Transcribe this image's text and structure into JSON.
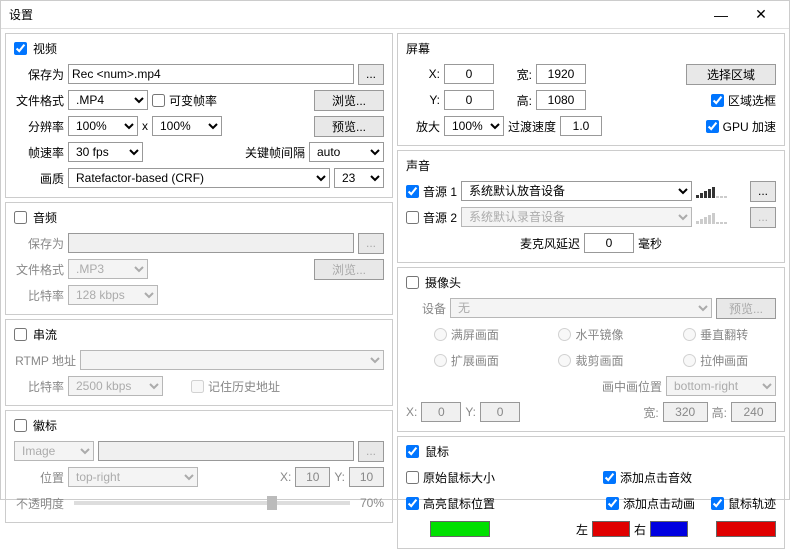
{
  "window": {
    "title": "设置",
    "min": "—",
    "close": "✕"
  },
  "video": {
    "title": "视频",
    "checked": true,
    "saveas_lbl": "保存为",
    "saveas_val": "Rec <num>.mp4",
    "more": "...",
    "format_lbl": "文件格式",
    "format_val": ".MP4",
    "vbr_lbl": "可变帧率",
    "browse": "浏览...",
    "res_lbl": "分辨率",
    "res_w": "100%",
    "res_x": "x",
    "res_h": "100%",
    "preview": "预览...",
    "fps_lbl": "帧速率",
    "fps_val": "30 fps",
    "keyframe_lbl": "关键帧间隔",
    "keyframe_val": "auto",
    "quality_lbl": "画质",
    "quality_val": "Ratefactor-based (CRF)",
    "crf_val": "23"
  },
  "audio": {
    "title": "音频",
    "checked": false,
    "saveas_lbl": "保存为",
    "saveas_val": "",
    "more": "...",
    "format_lbl": "文件格式",
    "format_val": ".MP3",
    "browse": "浏览...",
    "bitrate_lbl": "比特率",
    "bitrate_val": "128 kbps"
  },
  "stream": {
    "title": "串流",
    "checked": false,
    "rtmp_lbl": "RTMP 地址",
    "rtmp_val": "",
    "bitrate_lbl": "比特率",
    "bitrate_val": "2500 kbps",
    "remember_lbl": "记住历史地址"
  },
  "emblem": {
    "title": "徽标",
    "checked": false,
    "type_val": "Image",
    "more": "...",
    "pos_lbl": "位置",
    "pos_val": "top-right",
    "x_lbl": "X:",
    "x_val": "10",
    "y_lbl": "Y:",
    "y_val": "10",
    "opacity_lbl": "不透明度",
    "opacity_val": "70%"
  },
  "screen": {
    "title": "屏幕",
    "x_lbl": "X:",
    "x_val": "0",
    "w_lbl": "宽:",
    "w_val": "1920",
    "select_region": "选择区域",
    "y_lbl": "Y:",
    "y_val": "0",
    "h_lbl": "高:",
    "h_val": "1080",
    "region_frame": "区域选框",
    "zoom_lbl": "放大",
    "zoom_val": "100%",
    "transition_lbl": "过渡速度",
    "transition_val": "1.0",
    "gpu_lbl": "GPU 加速"
  },
  "sound": {
    "title": "声音",
    "src1_lbl": "音源 1",
    "src1_val": "系统默认放音设备",
    "src1_checked": true,
    "more": "...",
    "src2_lbl": "音源 2",
    "src2_val": "系统默认录音设备",
    "src2_checked": false,
    "micdelay_lbl": "麦克风延迟",
    "micdelay_val": "0",
    "ms": "毫秒"
  },
  "camera": {
    "title": "摄像头",
    "checked": false,
    "device_lbl": "设备",
    "device_val": "无",
    "preview": "预览...",
    "opt_fullscreen": "满屏画面",
    "opt_hflip": "水平镜像",
    "opt_vflip": "垂直翻转",
    "opt_extend": "扩展画面",
    "opt_crop": "裁剪画面",
    "opt_stretch": "拉伸画面",
    "pip_lbl": "画中画位置",
    "pip_val": "bottom-right",
    "x_lbl": "X:",
    "x_val": "0",
    "y_lbl": "Y:",
    "y_val": "0",
    "w_lbl": "宽:",
    "w_val": "320",
    "h_lbl": "高:",
    "h_val": "240"
  },
  "mouse": {
    "title": "鼠标",
    "checked": true,
    "orig_size": "原始鼠标大小",
    "click_sound": "添加点击音效",
    "highlight": "高亮鼠标位置",
    "click_anim": "添加点击动画",
    "trail": "鼠标轨迹",
    "left_lbl": "左",
    "right_lbl": "右",
    "colors": {
      "highlight": "#00e000",
      "left": "#e00000",
      "right": "#0000e0",
      "trail": "#e00000"
    }
  }
}
